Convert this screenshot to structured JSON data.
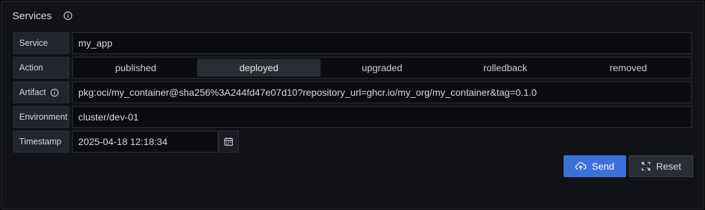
{
  "panel": {
    "title": "Services"
  },
  "form": {
    "service": {
      "label": "Service",
      "value": "my_app"
    },
    "action": {
      "label": "Action",
      "options": [
        "published",
        "deployed",
        "upgraded",
        "rolledback",
        "removed"
      ],
      "selected": "deployed"
    },
    "artifact": {
      "label": "Artifact",
      "value": "pkg:oci/my_container@sha256%3A244fd47e07d10?repository_url=ghcr.io/my_org/my_container&tag=0.1.0"
    },
    "environment": {
      "label": "Environment",
      "value": "cluster/dev-01"
    },
    "timestamp": {
      "label": "Timestamp",
      "value": "2025-04-18 12:18:34"
    }
  },
  "buttons": {
    "send": "Send",
    "reset": "Reset"
  },
  "colors": {
    "accent": "#3d71d9",
    "background": "#111217"
  }
}
